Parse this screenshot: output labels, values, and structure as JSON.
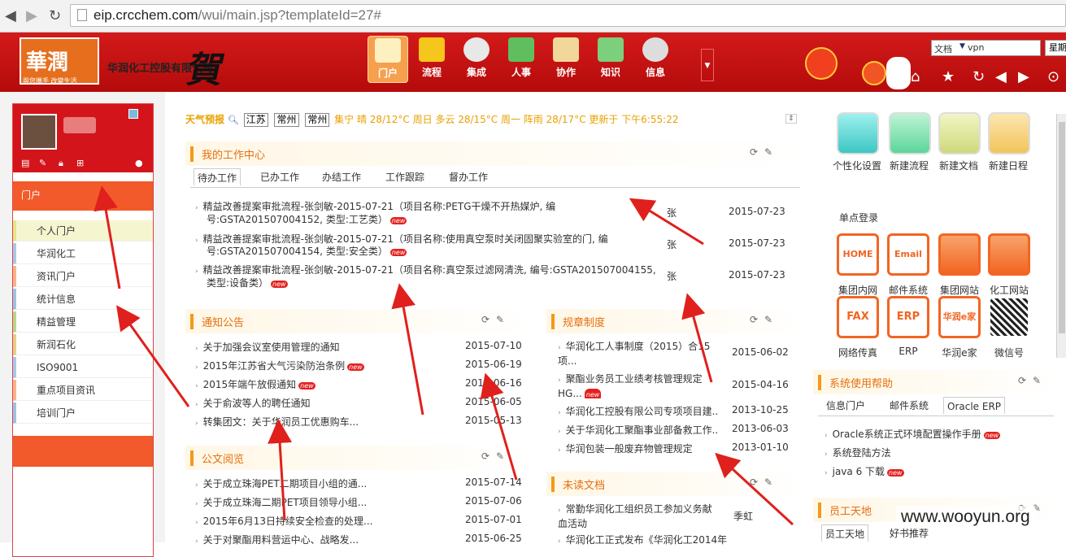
{
  "browser": {
    "url_domain": "eip.crcchem.com",
    "url_path": "/wui/main.jsp?templateId=27#"
  },
  "header": {
    "company": "华润化工控股有限公司",
    "logo_text": "華潤",
    "logo_tagline": "與您攜手 改變生活",
    "he_char": "賀",
    "nav": [
      {
        "label": "门户"
      },
      {
        "label": "流程"
      },
      {
        "label": "集成"
      },
      {
        "label": "人事"
      },
      {
        "label": "协作"
      },
      {
        "label": "知识"
      },
      {
        "label": "信息"
      }
    ],
    "search_scope": "文档",
    "search_value": "vpn",
    "search_btn": "星期"
  },
  "sidebar": {
    "portal_heading": "门户",
    "items": [
      {
        "label": "个人门户"
      },
      {
        "label": "华润化工"
      },
      {
        "label": "资讯门户"
      },
      {
        "label": "统计信息"
      },
      {
        "label": "精益管理"
      },
      {
        "label": "新润石化"
      },
      {
        "label": "ISO9001"
      },
      {
        "label": "重点项目资讯"
      },
      {
        "label": "培训门户"
      }
    ]
  },
  "weather": {
    "label": "天气预报",
    "province": "江苏",
    "city1": "常州",
    "city2": "常州",
    "text": "集宁 晴 28/12°C  周日 多云 28/15°C  周一 阵雨 28/17°C  更新于 下午6:55:22"
  },
  "work": {
    "title": "我的工作中心",
    "tabs": [
      "待办工作",
      "已办工作",
      "办结工作",
      "工作跟踪",
      "督办工作"
    ],
    "rows": [
      {
        "l1": "精益改善提案审批流程-张剑敏-2015-07-21（项目名称:PETG干燥不开热媒炉, 编",
        "l2": "号:GSTA201507004152, 类型:工艺类）",
        "person": "张",
        "date": "2015-07-23"
      },
      {
        "l1": "精益改善提案审批流程-张剑敏-2015-07-21（项目名称:使用真空泵时关闭固聚实验室的门, 编",
        "l2": "号:GSTA201507004154, 类型:安全类）",
        "person": "张",
        "date": "2015-07-23"
      },
      {
        "l1": "精益改善提案审批流程-张剑敏-2015-07-21（项目名称:真空泵过滤网清洗, 编号:GSTA201507004155,",
        "l2": "类型:设备类）",
        "person": "张",
        "date": "2015-07-23"
      }
    ],
    "new_tag": "new"
  },
  "notice": {
    "title": "通知公告",
    "rows": [
      {
        "text": "关于加强会议室使用管理的通知",
        "date": "2015-07-10",
        "new": false
      },
      {
        "text": "2015年江苏省大气污染防治条例",
        "date": "2015-06-19",
        "new": true
      },
      {
        "text": "2015年端午放假通知",
        "date": "2015-06-16",
        "new": true
      },
      {
        "text": "关于俞波等人的聘任通知",
        "date": "2015-06-05",
        "new": false
      },
      {
        "text": "转集团文：关于华润员工优惠购车...",
        "date": "2015-05-13",
        "new": false
      }
    ]
  },
  "rules": {
    "title": "规章制度",
    "rows": [
      {
        "text": "华润化工人事制度（2015）合15项...",
        "date": "2015-06-02"
      },
      {
        "text": "聚酯业务员工业绩考核管理规定HG...",
        "date": "2015-04-16",
        "new": true
      },
      {
        "text": "华润化工控股有限公司专项项目建...",
        "date": "2013-10-25"
      },
      {
        "text": "关于华润化工聚酯事业部备救工作...",
        "date": "2013-06-03"
      },
      {
        "text": "华润包装一般废弃物管理规定",
        "date": "2013-01-10"
      }
    ]
  },
  "docs": {
    "title": "公文阅览",
    "rows": [
      {
        "text": "关于成立珠海PET二期项目小组的通...",
        "date": "2015-07-14"
      },
      {
        "text": "关于成立珠海二期PET项目领导小组...",
        "date": "2015-07-06"
      },
      {
        "text": "2015年6月13日持续安全检查的处理...",
        "date": "2015-07-01"
      },
      {
        "text": "关于对聚酯用料营运中心、战略发...",
        "date": "2015-06-25"
      }
    ]
  },
  "unread": {
    "title": "未读文档",
    "rows": [
      {
        "text": "常勤华润化工组织员工参加义务献血活动",
        "person": "季虹"
      },
      {
        "text": "华润化工正式发布《华润化工2014年",
        "person": ""
      }
    ]
  },
  "apps": [
    {
      "label": "个性化设置"
    },
    {
      "label": "新建流程"
    },
    {
      "label": "新建文档"
    },
    {
      "label": "新建日程"
    }
  ],
  "sso": {
    "title": "单点登录",
    "items": [
      {
        "icon": "HOME",
        "label": "集团内网"
      },
      {
        "icon": "Email",
        "label": "邮件系统"
      },
      {
        "icon": "",
        "label": "集团网站"
      },
      {
        "icon": "",
        "label": "化工网站"
      },
      {
        "icon": "FAX",
        "label": "网络传真"
      },
      {
        "icon": "ERP",
        "label": "ERP"
      },
      {
        "icon": "华润e家",
        "label": "华润e家"
      },
      {
        "icon": "",
        "label": "微信号"
      }
    ]
  },
  "help": {
    "title": "系统使用帮助",
    "tabs": [
      "信息门户",
      "邮件系统",
      "Oracle ERP"
    ],
    "rows": [
      {
        "text": "Oracle系统正式环境配置操作手册",
        "new": true
      },
      {
        "text": "系统登陆方法",
        "new": false
      },
      {
        "text": "java 6 下载",
        "new": true
      }
    ]
  },
  "staff": {
    "title": "员工天地",
    "tabs": [
      "员工天地",
      "好书推荐"
    ]
  },
  "watermark": "www.wooyun.org",
  "colors": {
    "header_red": "#c51313",
    "accent_orange": "#f26522",
    "title_orange": "#e66f0c"
  }
}
